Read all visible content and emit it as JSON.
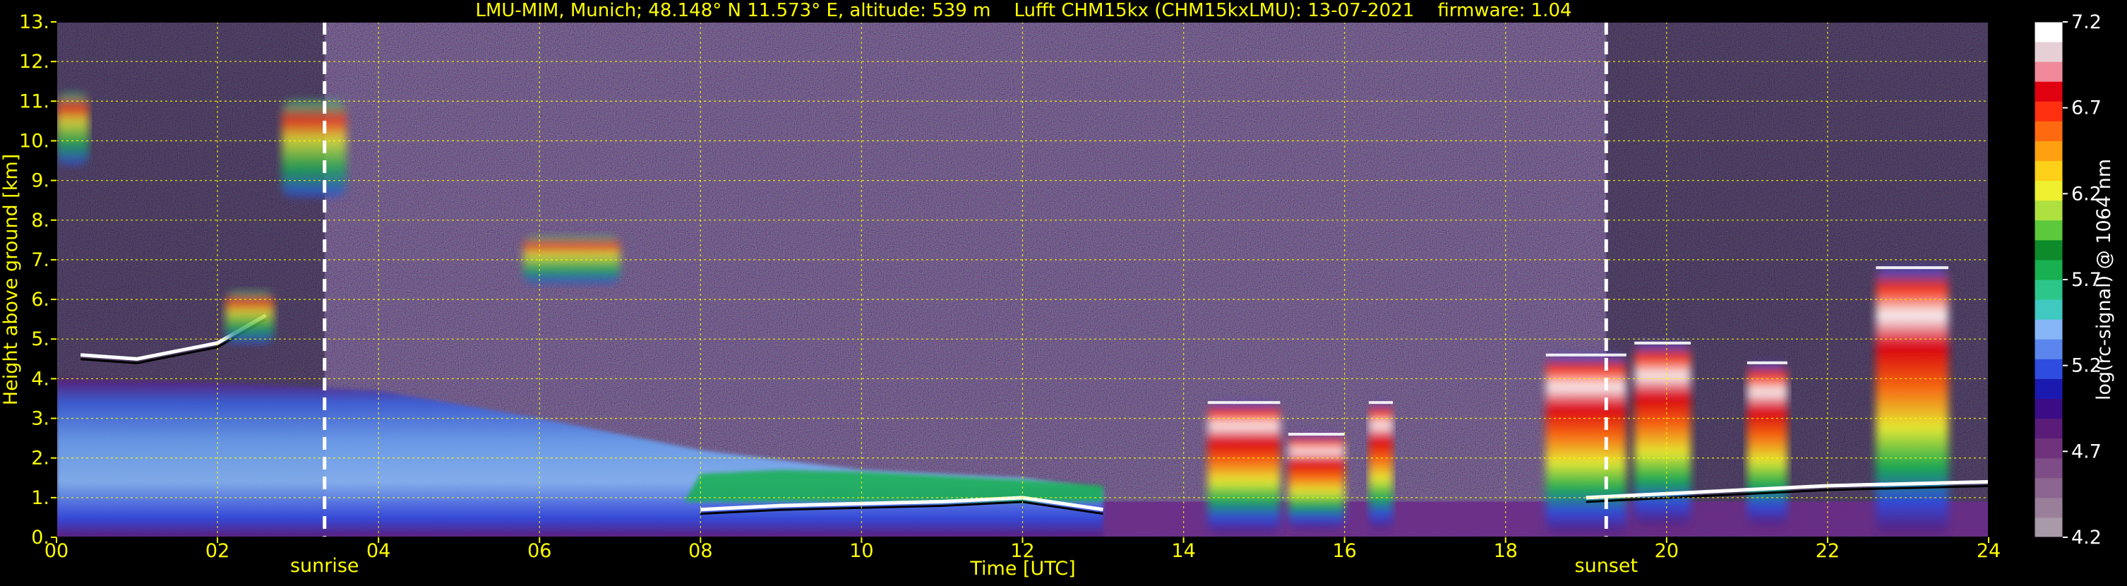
{
  "chart_data": {
    "type": "heatmap",
    "title": "LMU-MIM, Munich; 48.148° N 11.573° E, altitude: 539 m    Lufft CHM15kx (CHM15kxLMU): 13-07-2021    firmware: 1.04",
    "xlabel": "Time [UTC]",
    "ylabel": "Height above ground [km]",
    "xlim": [
      0,
      24
    ],
    "ylim": [
      0,
      13
    ],
    "x_ticks": [
      "00",
      "02",
      "04",
      "06",
      "08",
      "10",
      "12",
      "14",
      "16",
      "18",
      "20",
      "22",
      "24"
    ],
    "y_ticks": [
      "0.",
      "1.",
      "2.",
      "3.",
      "4.",
      "5.",
      "6.",
      "7.",
      "8.",
      "9.",
      "10.",
      "11.",
      "12.",
      "13."
    ],
    "grid": true,
    "annotations": [
      {
        "label": "sunrise",
        "x": 3.33
      },
      {
        "label": "sunset",
        "x": 19.25
      }
    ],
    "colorbar": {
      "label": "log(rc-signal) @ 1064 nm",
      "range": [
        4.2,
        7.2
      ],
      "ticks": [
        "4.2",
        "4.7",
        "5.2",
        "5.7",
        "6.2",
        "6.7",
        "7.2"
      ],
      "colors": [
        "#a89aa8",
        "#9a7f9a",
        "#8c6590",
        "#7e4c86",
        "#70327c",
        "#5a1c78",
        "#3a0d86",
        "#1a1ab0",
        "#2f4ce0",
        "#5a86ee",
        "#86b6f6",
        "#3fc9c0",
        "#2cc68a",
        "#18b050",
        "#0d8a2a",
        "#5cc83c",
        "#aee040",
        "#eef030",
        "#ffd018",
        "#ffa010",
        "#ff6a10",
        "#ff3010",
        "#e00010",
        "#f08a9a",
        "#e6d0d6",
        "#ffffff"
      ]
    },
    "series": [
      {
        "kind": "boundary_layer_aerosol",
        "x": [
          0,
          2,
          4,
          6,
          8,
          10,
          12,
          13
        ],
        "y_top": [
          4.0,
          3.9,
          3.7,
          3.0,
          2.2,
          1.7,
          1.5,
          1.2
        ]
      },
      {
        "kind": "morning_residual_layer_top",
        "x": [
          0.3,
          1.0,
          2.0,
          2.6
        ],
        "y": [
          4.6,
          4.5,
          4.9,
          5.6
        ]
      },
      {
        "kind": "cirrus_cloud",
        "x_start": 0,
        "x_end": 0.4,
        "y_base": 9.4,
        "y_top": 11.2
      },
      {
        "kind": "cirrus_cloud",
        "x_start": 2.8,
        "x_end": 3.6,
        "y_base": 8.6,
        "y_top": 11.0
      },
      {
        "kind": "mid_level_cloud",
        "x_start": 2.1,
        "x_end": 2.7,
        "y_base": 4.9,
        "y_top": 6.2
      },
      {
        "kind": "mid_level_cloud",
        "x_start": 5.8,
        "x_end": 7.0,
        "y_base": 6.4,
        "y_top": 7.6
      },
      {
        "kind": "cloud_base_line",
        "x": [
          8,
          9,
          10,
          11,
          12,
          13
        ],
        "y": [
          0.7,
          0.8,
          0.85,
          0.9,
          1.0,
          0.7
        ]
      },
      {
        "kind": "convective_cloud",
        "x_start": 14.3,
        "x_end": 15.2,
        "y_base": 0.1,
        "y_top": 3.4
      },
      {
        "kind": "convective_cloud",
        "x_start": 15.3,
        "x_end": 16.0,
        "y_base": 0.2,
        "y_top": 2.6
      },
      {
        "kind": "convective_cloud",
        "x_start": 16.3,
        "x_end": 16.6,
        "y_base": 0.2,
        "y_top": 3.4
      },
      {
        "kind": "convective_cloud",
        "x_start": 18.5,
        "x_end": 19.5,
        "y_base": 0.1,
        "y_top": 4.6
      },
      {
        "kind": "convective_cloud",
        "x_start": 19.6,
        "x_end": 20.3,
        "y_base": 0.3,
        "y_top": 4.9
      },
      {
        "kind": "convective_cloud",
        "x_start": 21.0,
        "x_end": 21.5,
        "y_base": 0.3,
        "y_top": 4.4
      },
      {
        "kind": "convective_cloud",
        "x_start": 22.6,
        "x_end": 23.5,
        "y_base": 0.1,
        "y_top": 6.8
      },
      {
        "kind": "evening_boundary_layer_top",
        "x": [
          19,
          20,
          21,
          22,
          23,
          24
        ],
        "y": [
          1.0,
          1.1,
          1.2,
          1.3,
          1.35,
          1.4
        ]
      }
    ]
  }
}
